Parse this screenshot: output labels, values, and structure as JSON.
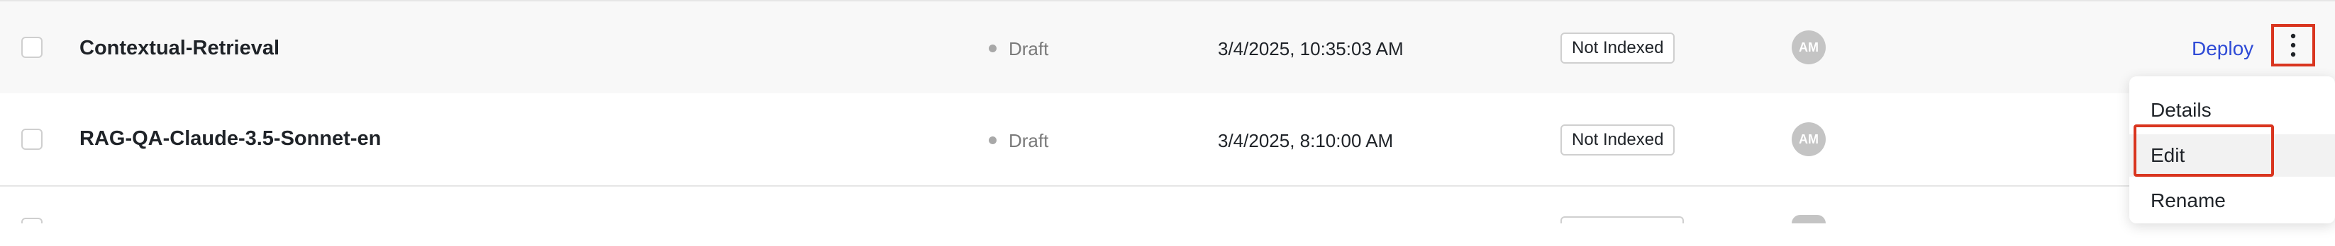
{
  "rows": [
    {
      "name": "Contextual-Retrieval",
      "status": "Draft",
      "date": "3/4/2025, 10:35:03 AM",
      "index_badge": "Not Indexed",
      "avatar_initials": "AM"
    },
    {
      "name": "RAG-QA-Claude-3.5-Sonnet-en",
      "status": "Draft",
      "date": "3/4/2025, 8:10:00 AM",
      "index_badge": "Not Indexed",
      "avatar_initials": "AM"
    }
  ],
  "actions": {
    "deploy_label": "Deploy",
    "more_icon": "kebab-vertical-icon"
  },
  "context_menu": {
    "items": [
      "Details",
      "Edit",
      "Rename"
    ],
    "highlighted": "Edit"
  },
  "colors": {
    "accent_link": "#2f4bd6",
    "highlight_border": "#d9351f",
    "status_dot": "#a8a8a8"
  }
}
